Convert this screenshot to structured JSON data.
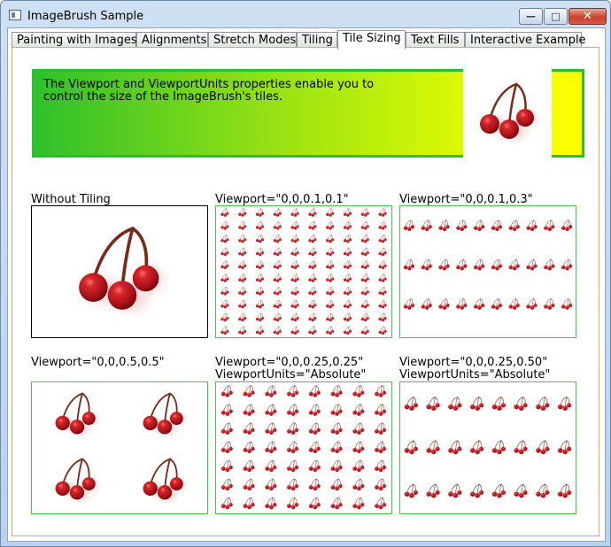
{
  "window": {
    "title": "ImageBrush Sample"
  },
  "tabs": [
    {
      "label": "Painting with Images",
      "selected": false
    },
    {
      "label": "Alignments",
      "selected": false
    },
    {
      "label": "Stretch Modes",
      "selected": false
    },
    {
      "label": "Tiling",
      "selected": false
    },
    {
      "label": "Tile Sizing",
      "selected": true
    },
    {
      "label": "Text Fills",
      "selected": false
    },
    {
      "label": "Interactive Example",
      "selected": false
    }
  ],
  "banner": {
    "text": "The Viewport and ViewportUnits properties enable you to control the size of the ImageBrush's tiles.",
    "icon": "cherries-image"
  },
  "samples": [
    {
      "caption": "Without Tiling",
      "units": "",
      "viewport": [
        0,
        0,
        1,
        1
      ]
    },
    {
      "caption": "Viewport=\"0,0,0.1,0.1\"",
      "units": "",
      "viewport": [
        0,
        0,
        0.1,
        0.1
      ]
    },
    {
      "caption": "Viewport=\"0,0,0.1,0.3\"",
      "units": "",
      "viewport": [
        0,
        0,
        0.1,
        0.3
      ]
    },
    {
      "caption": "Viewport=\"0,0,0.5,0.5\"",
      "units": "",
      "viewport": [
        0,
        0,
        0.5,
        0.5
      ]
    },
    {
      "caption": "Viewport=\"0,0,0.25,0.25\"",
      "units": "ViewportUnits=\"Absolute\"",
      "viewport": [
        0,
        0,
        0.25,
        0.25
      ]
    },
    {
      "caption": "Viewport=\"0,0,0.25,0.50\"",
      "units": "ViewportUnits=\"Absolute\"",
      "viewport": [
        0,
        0,
        0.25,
        0.5
      ]
    }
  ],
  "colors": {
    "frame": "#3fc94a",
    "cherry": "#b3161c",
    "stem": "#7a2a1a"
  }
}
